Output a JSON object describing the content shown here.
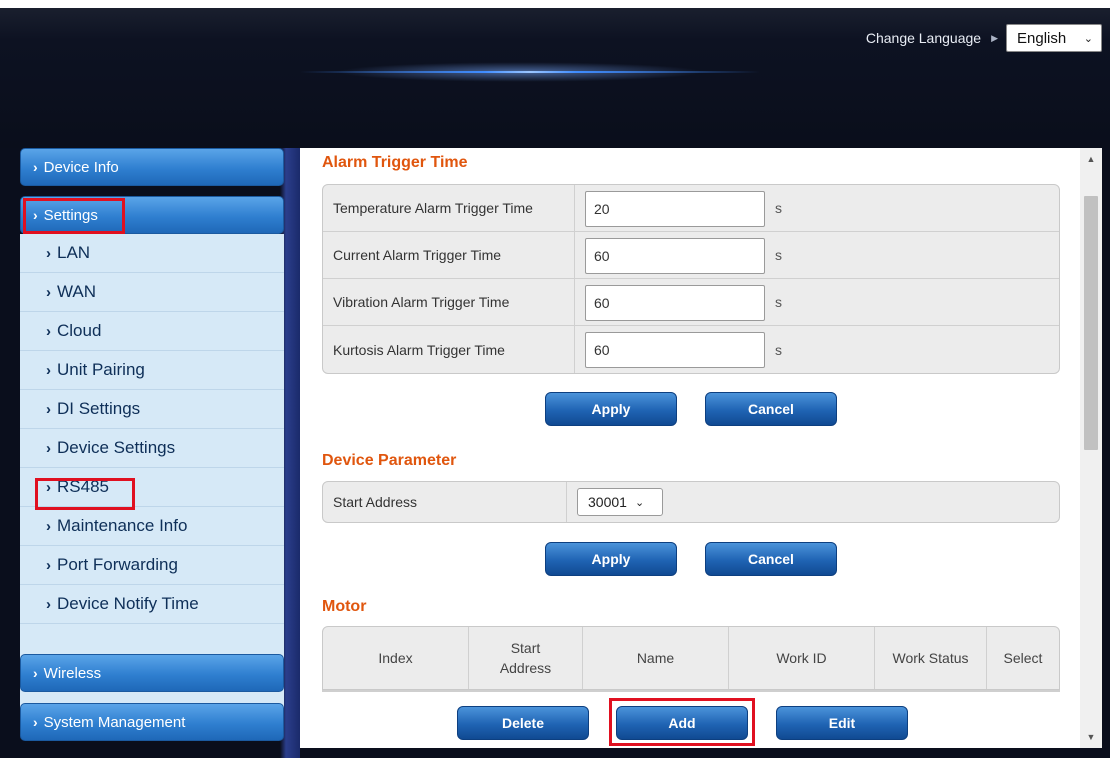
{
  "header": {
    "change_language_label": "Change Language",
    "language_value": "English"
  },
  "sidebar": {
    "device_info": "Device Info",
    "settings": "Settings",
    "items": [
      {
        "label": "LAN"
      },
      {
        "label": "WAN"
      },
      {
        "label": "Cloud"
      },
      {
        "label": "Unit Pairing"
      },
      {
        "label": "DI Settings"
      },
      {
        "label": "Device Settings"
      },
      {
        "label": "RS485"
      },
      {
        "label": "Maintenance Info"
      },
      {
        "label": "Port Forwarding"
      },
      {
        "label": "Device Notify Time"
      }
    ],
    "wireless": "Wireless",
    "system_management": "System Management"
  },
  "alarm_trigger": {
    "title": "Alarm Trigger Time",
    "rows": [
      {
        "label": "Temperature Alarm Trigger Time",
        "value": "20",
        "unit": "s"
      },
      {
        "label": "Current Alarm Trigger Time",
        "value": "60",
        "unit": "s"
      },
      {
        "label": "Vibration Alarm Trigger Time",
        "value": "60",
        "unit": "s"
      },
      {
        "label": "Kurtosis Alarm Trigger Time",
        "value": "60",
        "unit": "s"
      }
    ],
    "apply": "Apply",
    "cancel": "Cancel"
  },
  "device_parameter": {
    "title": "Device Parameter",
    "start_address_label": "Start Address",
    "start_address_value": "30001",
    "apply": "Apply",
    "cancel": "Cancel"
  },
  "motor": {
    "title": "Motor",
    "columns": [
      "Index",
      "Start\nAddress",
      "Name",
      "Work ID",
      "Work Status",
      "Select"
    ],
    "delete": "Delete",
    "add": "Add",
    "edit": "Edit"
  },
  "colors": {
    "accent_title": "#e0560e",
    "button_blue": "#1f63b3",
    "highlight_red": "#e01020"
  }
}
